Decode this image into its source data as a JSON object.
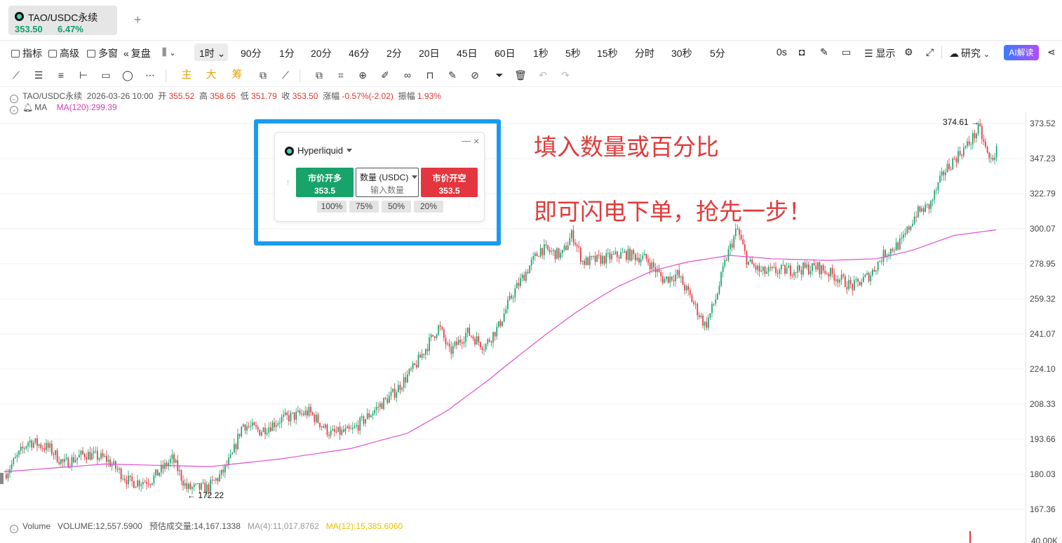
{
  "tab": {
    "title": "TAO/USDC永续",
    "price": "353.50",
    "change": "6.47%",
    "add": "+"
  },
  "toolbar": {
    "indicators": "指标",
    "advanced": "高级",
    "multiwindow": "多窗",
    "replay": "复盘",
    "interval_active": "1时 ⌄",
    "intervals": [
      "90分",
      "1分",
      "20分",
      "46分",
      "2分",
      "20日",
      "45日",
      "60日",
      "1秒",
      "5秒",
      "15秒",
      "分时",
      "30秒",
      "5分"
    ],
    "zero_s": "0s",
    "display": "显示",
    "research": "研究",
    "ai": "AI解读"
  },
  "drawtools": {
    "main": "主",
    "big": "大",
    "chips": "筹"
  },
  "info": {
    "symbol": "TAO/USDC永续",
    "datetime": "2026-03-26 10:00",
    "open_label": "开",
    "open": "355.52",
    "high_label": "高",
    "high": "358.65",
    "low_label": "低",
    "low": "351.79",
    "close_label": "收",
    "close": "353.50",
    "chg_label": "涨幅",
    "chg": "-0.57%(-2.02)",
    "amp_label": "振幅",
    "amp": "1.93%",
    "ma_label": "MA",
    "ma_value": "MA(120):299.39"
  },
  "chart_data": {
    "type": "candlestick",
    "y_ticks": [
      "373.52",
      "347.23",
      "322.79",
      "300.07",
      "278.95",
      "259.32",
      "241.07",
      "224.10",
      "208.33",
      "193.66",
      "180.03",
      "167.36"
    ],
    "volume_tick": "40.00K",
    "high_marker": "374.61 →",
    "low_marker": "← 172.22",
    "ylim": [
      167.36,
      374.61
    ],
    "ma120_end": 299.39
  },
  "volume": {
    "label": "Volume",
    "volume": "VOLUME:12,557.5900",
    "predicted": "预估成交量:14,167.1338",
    "ma4": "MA(4):11,017.8762",
    "ma12": "MA(12):15,385.6060"
  },
  "panel": {
    "exchange": "Hyperliquid",
    "minimize": "—",
    "close": "×",
    "long_label": "市价开多",
    "long_price": "353.5",
    "qty_select": "数量 (USDC)",
    "qty_placeholder": "输入数量",
    "short_label": "市价开空",
    "short_price": "353.5",
    "pcts": [
      "100%",
      "75%",
      "50%",
      "20%"
    ]
  },
  "annotations": {
    "line1": "填入数量或百分比",
    "line2": "即可闪电下单，抢先一步！"
  },
  "colors": {
    "up": "#17a36a",
    "down": "#e4363f",
    "ma": "#e04fd0",
    "highlight": "#1a9bf0",
    "annotation": "#e03b3b"
  }
}
